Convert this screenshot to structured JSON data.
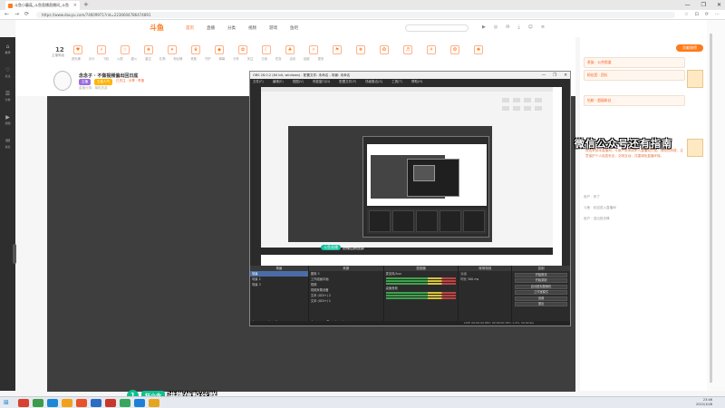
{
  "browser": {
    "tab_title": "斗鱼小蘑菇_斗鱼直播直播间_斗鱼",
    "tab_close": "×",
    "new_tab": "+",
    "url": "https://www.douyu.com/74609971?rid=2236604786474891",
    "back": "←",
    "forward": "→",
    "reload": "⟳",
    "window_controls": [
      "—",
      "❐",
      "✕"
    ],
    "toolbar_icons": [
      "☆",
      "⊡",
      "⟳",
      "⋯"
    ]
  },
  "site": {
    "logo": "斗鱼",
    "nav": [
      "首页",
      "直播",
      "分类",
      "视频",
      "游戏",
      "鱼吧"
    ],
    "nav_active_index": 1,
    "header_icons": [
      "▶",
      "◎",
      "✉",
      "⤓",
      "☺",
      "≡"
    ]
  },
  "sidebar": {
    "items": [
      {
        "icon": "⌂",
        "label": "推荐"
      },
      {
        "icon": "♡",
        "label": "关注"
      },
      {
        "icon": "☰",
        "label": "分类"
      },
      {
        "icon": "▶",
        "label": "视频"
      },
      {
        "icon": "✉",
        "label": "消息"
      }
    ]
  },
  "streamer": {
    "fans_count": "12",
    "fans_label": "主播等级",
    "gifts": [
      "♥",
      "⚡",
      "☆",
      "❀",
      "✦",
      "♛",
      "◆",
      "✿",
      "☾",
      "♣",
      "✧",
      "⚑",
      "❖",
      "✪",
      "♬",
      "⚘",
      "❂",
      "✺"
    ],
    "gift_labels": [
      "荧光棒",
      "办卡",
      "飞机",
      "火箭",
      "超火",
      "星空",
      "礼物",
      "粉丝牌",
      "贵族",
      "守护",
      "弹幕",
      "分享",
      "关注",
      "订阅",
      "任务",
      "活动",
      "抽奖",
      "更多"
    ],
    "title": "念念子 · 不做视频偏出回日底",
    "tags": [
      "主播",
      "王者人气"
    ],
    "meta_link": "已关注 · 分享 · 举报",
    "meta2": "直播分类：单机热游"
  },
  "right_panel": {
    "rank_button": "贡献周榜",
    "cards": [
      {
        "text": "贵族 · 公共频道"
      },
      {
        "text": "粉丝团 · 团长"
      },
      {
        "text": "钻粉 · 超级粉丝"
      }
    ],
    "notice": "欢迎来到本直播间，斗鱼严禁未成年人直播或打赏。请理性消费，注意保护个人信息安全，文明互动，共建绿色直播环境。",
    "chat": [
      "用户 · 来了",
      "斗鱼 · 欢迎进入直播间",
      "用户 · 送出荧光棒"
    ]
  },
  "obs": {
    "title": "OBS 28.0.2 (64 bit, windows) - 配置文件: 未命名 - 场景: 未命名",
    "window_controls": [
      "—",
      "❐",
      "✕"
    ],
    "menu": [
      "文件(F)",
      "编辑(E)",
      "视图(V)",
      "停靠窗口(D)",
      "配置文件(P)",
      "场景集合(S)",
      "工具(T)",
      "帮助(H)"
    ],
    "nested_badge": "斗鱼直播",
    "nested_badge_text": "进微信粉丝群",
    "docks": {
      "scenes": {
        "title": "场景",
        "items": [
          "场景",
          "场景 2",
          "场景 3"
        ],
        "selected": 0,
        "footer": "+ − ∧ ∨"
      },
      "sources": {
        "title": "来源",
        "items": [
          "图像 3",
          "工作组画中画",
          "视频",
          "视频采集设备",
          "文本 (GDI+) 2",
          "文本 (GDI+) 1"
        ],
        "selected": -1,
        "footer": "+ − ⚙ ∧ ∨"
      },
      "mixer": {
        "title": "混音器",
        "items": [
          "麦克风/Aux",
          "桌面音频"
        ]
      },
      "transitions": {
        "title": "转场特效",
        "items": [
          "淡出",
          "时长 300 ms"
        ]
      },
      "controls": {
        "title": "控制",
        "buttons": [
          "开始推流",
          "开始录制",
          "启动虚拟摄像机",
          "工作室模式",
          "设置",
          "退出"
        ]
      }
    },
    "status": "LIVE: 00:00:00   REC: 00:00:00   CPU: 1.2%, 30.00 fps"
  },
  "overlay": {
    "side_text": "微信公众号还有指南",
    "badge_number": "1",
    "badge_name": "狂小念",
    "badge_text": "进微信粉丝群"
  },
  "taskbar": {
    "start": "⊞",
    "apps": [
      "#d9412f",
      "#3c9c4a",
      "#1e88d8",
      "#f2a11c",
      "#e7522a",
      "#2c6cc4",
      "#c7372b",
      "#3ba55c",
      "#1f7fd8",
      "#e6a521"
    ],
    "time": "23:46",
    "date": "2022/10/8"
  },
  "colors": {
    "brand": "#ff7a1a",
    "accent": "#ff5d23",
    "badge": "#0fc08f",
    "video_bg": "#3e3e3e"
  }
}
